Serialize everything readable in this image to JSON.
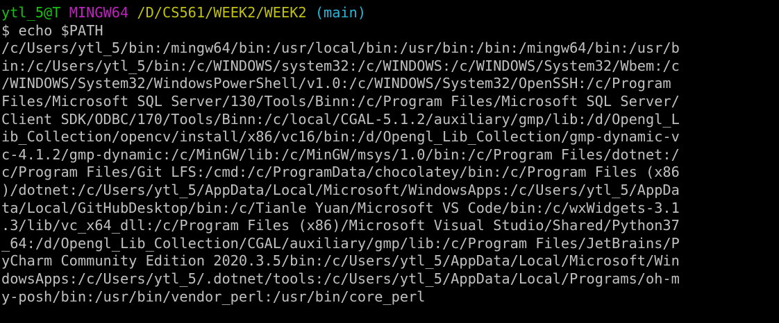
{
  "prompt": {
    "user_host": "ytl_5@T",
    "system": "MINGW64",
    "cwd": "/D/CS561/WEEK2/WEEK2",
    "branch": "(main)",
    "colors": {
      "user_host": "#17c10f",
      "system": "#bf22bf",
      "cwd": "#c1c10f",
      "branch": "#29b6d9"
    }
  },
  "command": {
    "symbol": "$",
    "text": "echo $PATH"
  },
  "output_lines": [
    "/c/Users/ytl_5/bin:/mingw64/bin:/usr/local/bin:/usr/bin:/bin:/mingw64/bin:/usr/b",
    "in:/c/Users/ytl_5/bin:/c/WINDOWS/system32:/c/WINDOWS:/c/WINDOWS/System32/Wbem:/c",
    "/WINDOWS/System32/WindowsPowerShell/v1.0:/c/WINDOWS/System32/OpenSSH:/c/Program ",
    "Files/Microsoft SQL Server/130/Tools/Binn:/c/Program Files/Microsoft SQL Server/",
    "Client SDK/ODBC/170/Tools/Binn:/c/local/CGAL-5.1.2/auxiliary/gmp/lib:/d/Opengl_L",
    "ib_Collection/opencv/install/x86/vc16/bin:/d/Opengl_Lib_Collection/gmp-dynamic-v",
    "c-4.1.2/gmp-dynamic:/c/MinGW/lib:/c/MinGW/msys/1.0/bin:/c/Program Files/dotnet:/",
    "c/Program Files/Git LFS:/cmd:/c/ProgramData/chocolatey/bin:/c/Program Files (x86",
    ")/dotnet:/c/Users/ytl_5/AppData/Local/Microsoft/WindowsApps:/c/Users/ytl_5/AppDa",
    "ta/Local/GitHubDesktop/bin:/c/Tianle Yuan/Microsoft VS Code/bin:/c/wxWidgets-3.1",
    ".3/lib/vc_x64_dll:/c/Program Files (x86)/Microsoft Visual Studio/Shared/Python37",
    "_64:/d/Opengl_Lib_Collection/CGAL/auxiliary/gmp/lib:/c/Program Files/JetBrains/P",
    "yCharm Community Edition 2020.3.5/bin:/c/Users/ytl_5/AppData/Local/Microsoft/Win",
    "dowsApps:/c/Users/ytl_5/.dotnet/tools:/c/Users/ytl_5/AppData/Local/Programs/oh-m",
    "y-posh/bin:/usr/bin/vendor_perl:/usr/bin/core_perl"
  ],
  "text_color": "#c0c0c0",
  "background": "#000000"
}
